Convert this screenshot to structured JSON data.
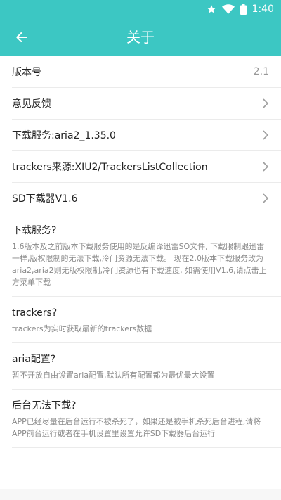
{
  "status_bar": {
    "time": "1:40",
    "icons": [
      "star-icon",
      "wifi-icon",
      "battery-icon"
    ]
  },
  "app_bar": {
    "title": "关于",
    "back_icon": "arrow-left-icon"
  },
  "colors": {
    "accent": "#3cc7c3",
    "text_primary": "#222222",
    "text_secondary": "#8a8a8a",
    "divider": "#ebebeb"
  },
  "settings": {
    "version": {
      "label": "版本号",
      "value": "2.1"
    },
    "feedback": {
      "label": "意见反馈"
    },
    "download_service": {
      "label": "下载服务:aria2_1.35.0"
    },
    "trackers_source": {
      "label": "trackers来源:XIU2/TrackersListCollection"
    },
    "sd_downloader": {
      "label": "SD下载器V1.6"
    }
  },
  "faq": [
    {
      "title": "下载服务?",
      "body": "1.6版本及之前版本下载服务使用的是反编译迅雷SO文件, 下载限制跟迅雷一样,版权限制的无法下载,冷门资源无法下载。 现在2.0版本下载服务改为aria2,aria2则无版权限制,冷门资源也有下载速度, 如需使用V1.6,请点击上方菜单下载"
    },
    {
      "title": "trackers?",
      "body": "trackers为实时获取最新的trackers数据"
    },
    {
      "title": "aria配置?",
      "body": "暂不开放自由设置aria配置,默认所有配置都为最优最大设置"
    },
    {
      "title": "后台无法下载?",
      "body": "APP已经尽量在后台运行不被杀死了，如果还是被手机杀死后台进程,请将APP前台运行或者在手机设置里设置允许SD下载器后台运行"
    }
  ]
}
